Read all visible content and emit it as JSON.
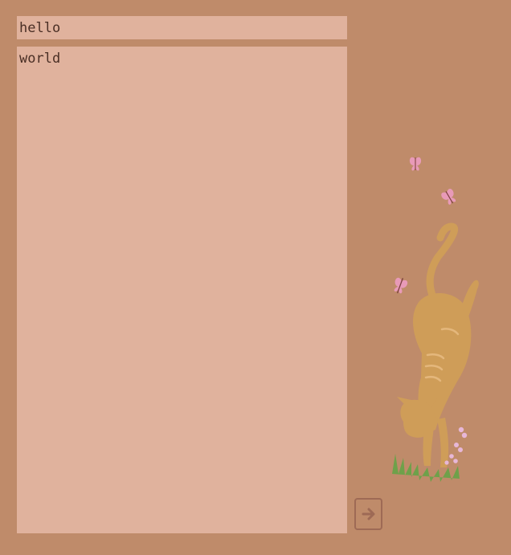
{
  "editor": {
    "title_value": "hello",
    "body_value": "world"
  },
  "illustration": {
    "icon": "cat-with-butterflies-illustration"
  },
  "submit": {
    "icon": "arrow-right-icon"
  },
  "colors": {
    "background": "#bf8b6a",
    "field": "#e0b29d",
    "text": "#4a2f25",
    "button_border": "#9e6a55",
    "cat": "#cf9d58",
    "butterfly": "#e89ab8",
    "grass": "#6ea14a",
    "flowers": "#e7b7d8"
  }
}
